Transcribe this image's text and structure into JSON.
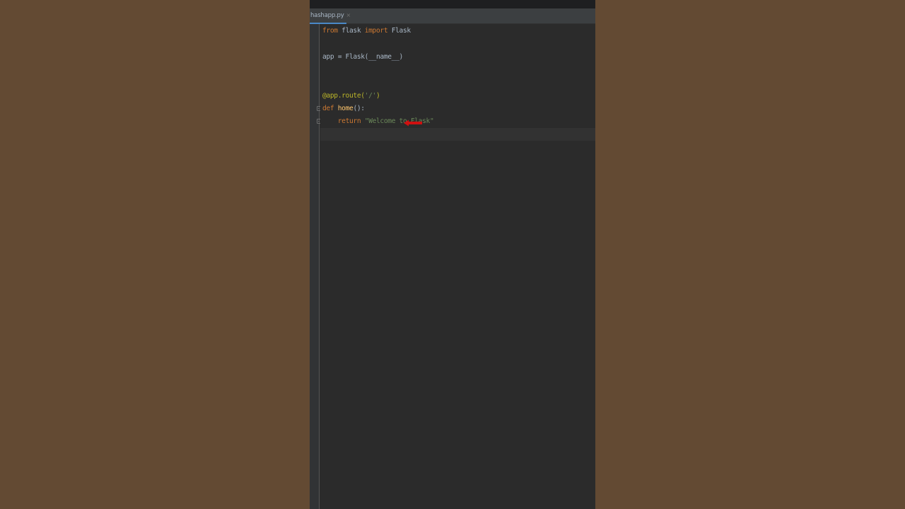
{
  "editor": {
    "tab": {
      "filename": "hashapp.py",
      "close_glyph": "×"
    },
    "code_lines": [
      {
        "parts": [
          {
            "t": "from",
            "c": "kw"
          },
          {
            "t": " flask ",
            "c": "plain"
          },
          {
            "t": "import",
            "c": "kw"
          },
          {
            "t": " Flask",
            "c": "plain"
          }
        ]
      },
      {
        "parts": [
          {
            "t": "app = Flask(__name__)",
            "c": "plain"
          }
        ]
      },
      {
        "parts": [
          {
            "t": "@app.route(",
            "c": "decor"
          },
          {
            "t": "'/'",
            "c": "str"
          },
          {
            "t": ")",
            "c": "decor"
          }
        ]
      },
      {
        "parts": [
          {
            "t": "def",
            "c": "kw"
          },
          {
            "t": " ",
            "c": "plain"
          },
          {
            "t": "home",
            "c": "fn"
          },
          {
            "t": "():",
            "c": "plain"
          }
        ]
      },
      {
        "parts": [
          {
            "t": "    ",
            "c": "plain"
          },
          {
            "t": "return",
            "c": "kw"
          },
          {
            "t": " ",
            "c": "plain"
          },
          {
            "t": "\"Welcome to Flask\"",
            "c": "str"
          }
        ]
      }
    ],
    "colors": {
      "background": "#2b2b2b",
      "keyword": "#cc7832",
      "decorator": "#bbb529",
      "function_name": "#ffc66d",
      "string": "#6a8759",
      "text": "#a9b7c6",
      "annotation_arrow": "#d01010",
      "page_background": "#634a33"
    },
    "annotation": {
      "icon": "left-arrow-icon",
      "points_to": "@app.route('/')"
    }
  }
}
